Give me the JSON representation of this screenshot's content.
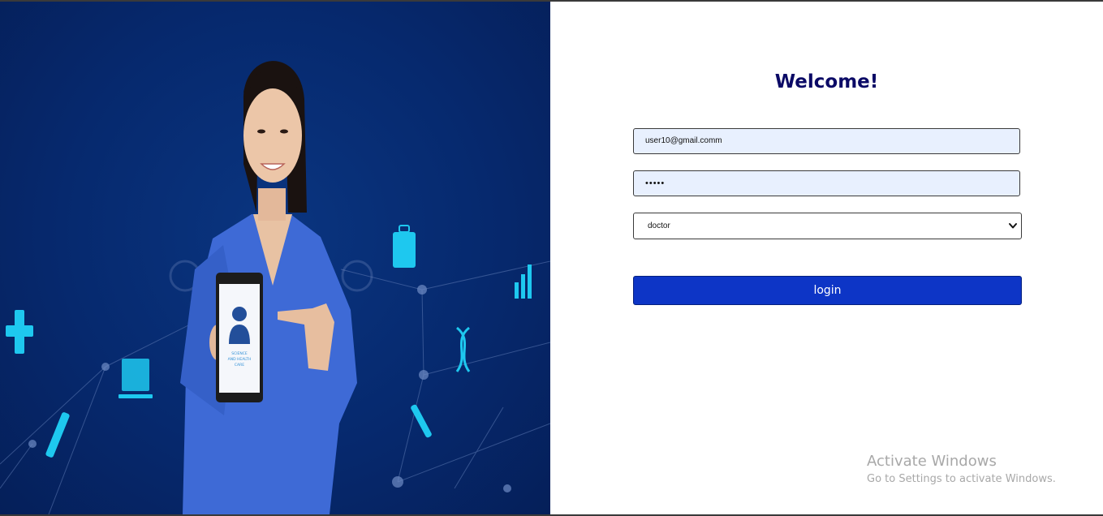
{
  "hero": {
    "alt": "Nurse holding a tablet with medical icons",
    "tablet_caption": [
      "SCIENCE",
      "AND HEALTH",
      "CARE"
    ]
  },
  "login_form": {
    "title": "Welcome!",
    "email_value": "user10@gmail.comm",
    "password_value": "•••••",
    "role_selected": "doctor",
    "submit_label": "login"
  },
  "os_watermark": {
    "title": "Activate Windows",
    "subtitle": "Go to Settings to activate Windows."
  },
  "colors": {
    "hero_background": "#06296e",
    "title": "#0b0a66",
    "input_fill": "#e8f0fe",
    "button": "#0d35c6",
    "icon_cyan": "#1ec8ef"
  }
}
